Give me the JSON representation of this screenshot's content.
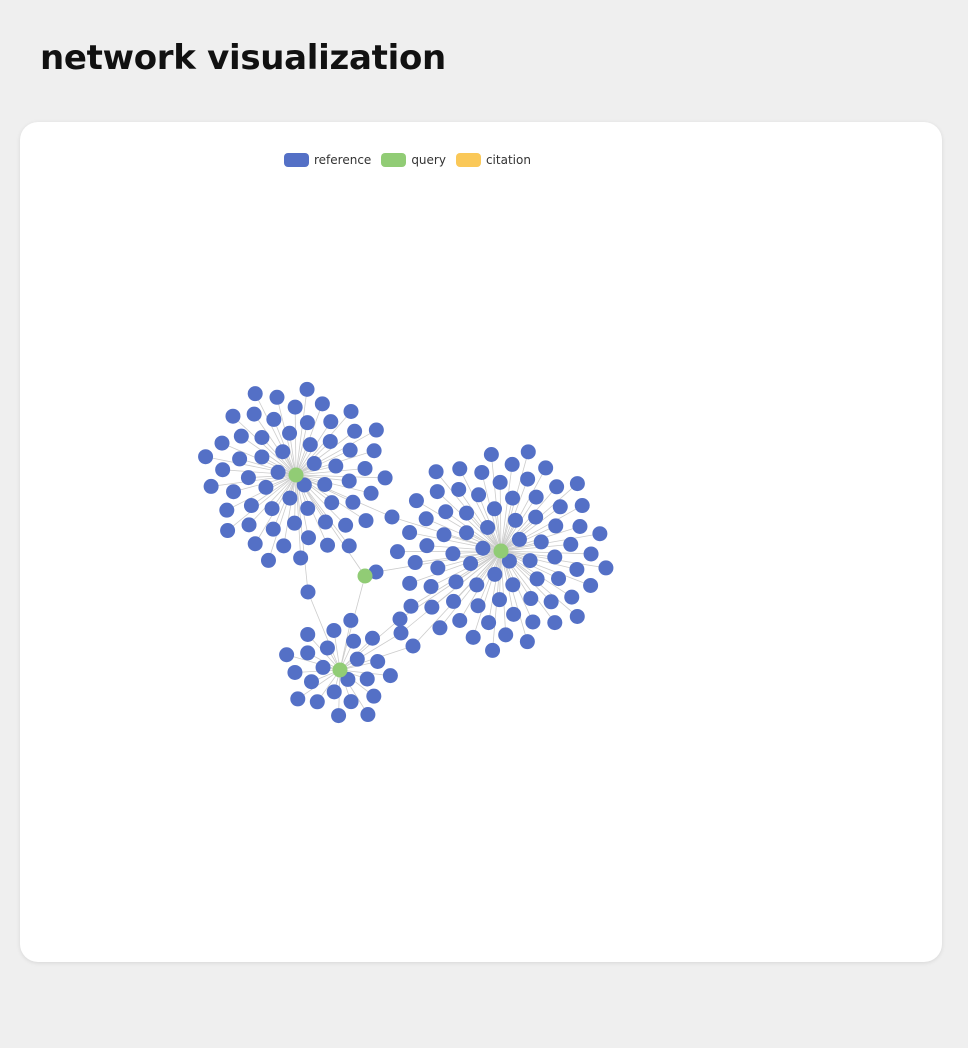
{
  "page": {
    "title": "network visualization"
  },
  "legend": [
    {
      "label": "reference",
      "color": "#5470c6"
    },
    {
      "label": "query",
      "color": "#91cc75"
    },
    {
      "label": "citation",
      "color": "#fac858"
    }
  ],
  "chart_data": {
    "type": "network",
    "categories": [
      "reference",
      "query",
      "citation"
    ],
    "edge_color": "#cccccc",
    "hubs": [
      {
        "id": "query-a",
        "category": "query",
        "leaves": 60
      },
      {
        "id": "query-b",
        "category": "query",
        "leaves": 76
      },
      {
        "id": "query-c",
        "category": "query",
        "leaves": 23
      },
      {
        "id": "query-d",
        "category": "query",
        "leaves": 0
      }
    ],
    "shared_references": [
      {
        "id": "ref-ab",
        "links": [
          "query-a",
          "query-b"
        ]
      },
      {
        "id": "ref-ac",
        "links": [
          "query-a",
          "query-c"
        ]
      },
      {
        "id": "ref-bd",
        "links": [
          "query-b",
          "query-d"
        ]
      },
      {
        "id": "ref-bc-1",
        "links": [
          "query-b",
          "query-c"
        ]
      },
      {
        "id": "ref-bc-2",
        "links": [
          "query-b",
          "query-c"
        ]
      },
      {
        "id": "ref-bc-3",
        "links": [
          "query-b",
          "query-c"
        ]
      }
    ],
    "hub_links": [
      [
        "query-d",
        "query-a"
      ],
      [
        "query-d",
        "query-c"
      ]
    ]
  }
}
